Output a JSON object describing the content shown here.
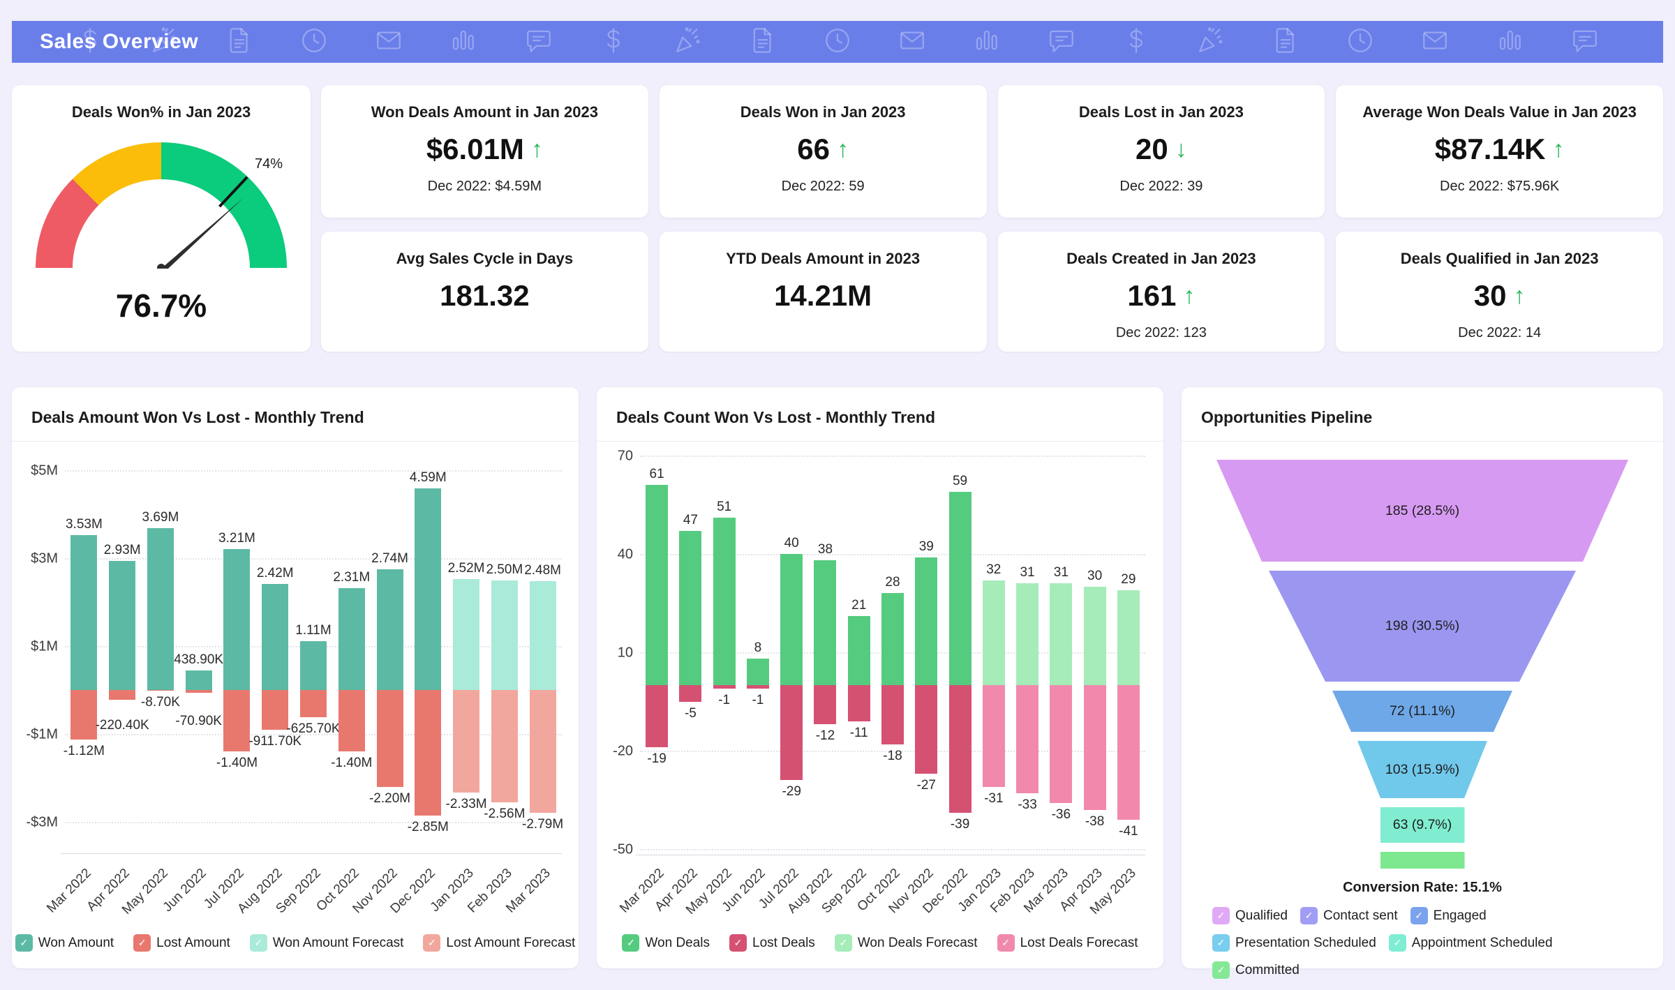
{
  "header": {
    "title": "Sales Overview",
    "bg_color": "#6a7eea",
    "icon_names": [
      "dollar-icon",
      "party-popper-icon",
      "document-icon",
      "clock-icon",
      "envelope-icon",
      "bar-chart-icon",
      "speech-bubble-icon"
    ]
  },
  "arrow_color": "#2db75c",
  "kpi_cards": [
    {
      "title": "Won Deals Amount in Jan 2023",
      "value": "$6.01M",
      "arrow": "up",
      "compare": "Dec 2022: $4.59M"
    },
    {
      "title": "Deals Won in Jan 2023",
      "value": "66",
      "arrow": "up",
      "compare": "Dec 2022: 59"
    },
    {
      "title": "Deals Lost in Jan 2023",
      "value": "20",
      "arrow": "down",
      "compare": "Dec 2022: 39"
    },
    {
      "title": "Average Won Deals Value in Jan 2023",
      "value": "$87.14K",
      "arrow": "up",
      "compare": "Dec 2022: $75.96K"
    },
    {
      "title": "Avg Sales Cycle in Days",
      "value": "181.32",
      "arrow": null,
      "compare": null
    },
    {
      "title": "YTD Deals Amount in 2023",
      "value": "14.21M",
      "arrow": null,
      "compare": null
    },
    {
      "title": "Deals Created in Jan 2023",
      "value": "161",
      "arrow": "up",
      "compare": "Dec 2022: 123"
    },
    {
      "title": "Deals Qualified in Jan 2023",
      "value": "30",
      "arrow": "up",
      "compare": "Dec 2022: 14"
    }
  ],
  "chart_data": [
    {
      "type": "gauge",
      "title": "Deals Won% in Jan 2023",
      "value": 76.7,
      "value_label": "76.7%",
      "target": 74,
      "target_label": "74%",
      "range": [
        0,
        100
      ],
      "zones": [
        {
          "upto": 25,
          "color": "#ef5b64"
        },
        {
          "upto": 50,
          "color": "#fbbd09"
        },
        {
          "upto": 100,
          "color": "#0bcb7c"
        }
      ]
    },
    {
      "type": "bar",
      "title": "Deals Amount Won Vs Lost - Monthly Trend",
      "unit": "USD (millions)",
      "categories": [
        "Mar 2022",
        "Apr 2022",
        "May 2022",
        "Jun 2022",
        "Jul 2022",
        "Aug 2022",
        "Sep 2022",
        "Oct 2022",
        "Nov 2022",
        "Dec 2022",
        "Jan 2023",
        "Feb 2023",
        "Mar 2023"
      ],
      "forecast_start_index": 10,
      "series": [
        {
          "name": "Won Amount",
          "color": "#5cbaa4",
          "forecast_color": "#a9ead9",
          "values": [
            3.53,
            2.93,
            3.69,
            0.4389,
            3.21,
            2.42,
            1.11,
            2.31,
            2.74,
            4.59,
            2.52,
            2.5,
            2.48
          ],
          "labels": [
            "3.53M",
            "2.93M",
            "3.69M",
            "438.90K",
            "3.21M",
            "2.42M",
            "1.11M",
            "2.31M",
            "2.74M",
            "4.59M",
            "2.52M",
            "2.50M",
            "2.48M"
          ]
        },
        {
          "name": "Lost Amount",
          "color": "#e8786e",
          "forecast_color": "#f2a79e",
          "values": [
            -1.12,
            -0.2204,
            -0.0087,
            -0.0709,
            -1.4,
            -0.9117,
            -0.6257,
            -1.4,
            -2.2,
            -2.85,
            -2.33,
            -2.56,
            -2.79
          ],
          "labels": [
            "-1.12M",
            "-220.40K",
            "-8.70K",
            "-70.90K",
            "-1.40M",
            "-911.70K",
            "-625.70K",
            "-1.40M",
            "-2.20M",
            "-2.85M",
            "-2.33M",
            "-2.56M",
            "-2.79M"
          ]
        }
      ],
      "y_ticks": [
        {
          "label": "$5M",
          "value": 5
        },
        {
          "label": "$3M",
          "value": 3
        },
        {
          "label": "$1M",
          "value": 1
        },
        {
          "label": "-$1M",
          "value": -1
        },
        {
          "label": "-$3M",
          "value": -3
        }
      ],
      "ylim": [
        -3.6,
        5.4
      ],
      "legend_position": "bottom",
      "legend": [
        {
          "label": "Won Amount",
          "color": "#5cbaa4"
        },
        {
          "label": "Lost Amount",
          "color": "#e8786e"
        },
        {
          "label": "Won Amount Forecast",
          "color": "#a9ead9"
        },
        {
          "label": "Lost Amount Forecast",
          "color": "#f2a79e"
        }
      ]
    },
    {
      "type": "bar",
      "title": "Deals Count Won Vs Lost - Monthly Trend",
      "unit": "deals",
      "categories": [
        "Mar 2022",
        "Apr 2022",
        "May 2022",
        "Jun 2022",
        "Jul 2022",
        "Aug 2022",
        "Sep 2022",
        "Oct 2022",
        "Nov 2022",
        "Dec 2022",
        "Jan 2023",
        "Feb 2023",
        "Mar 2023",
        "Apr 2023",
        "May 2023"
      ],
      "forecast_start_index": 10,
      "series": [
        {
          "name": "Won Deals",
          "color": "#55cb80",
          "forecast_color": "#a5ecb9",
          "values": [
            61,
            47,
            51,
            8,
            40,
            38,
            21,
            28,
            39,
            59,
            32,
            31,
            31,
            30,
            29
          ],
          "labels": [
            "61",
            "47",
            "51",
            "8",
            "40",
            "38",
            "21",
            "28",
            "39",
            "59",
            "32",
            "31",
            "31",
            "30",
            "29"
          ]
        },
        {
          "name": "Lost Deals",
          "color": "#d55172",
          "forecast_color": "#f189ad",
          "values": [
            -19,
            -5,
            -1,
            -1,
            -29,
            -12,
            -11,
            -18,
            -27,
            -39,
            -31,
            -33,
            -36,
            -38,
            -41
          ],
          "labels": [
            "-19",
            "-5",
            "-1",
            "-1",
            "-29",
            "-12",
            "-11",
            "-18",
            "-27",
            "-39",
            "-31",
            "-33",
            "-36",
            "-38",
            "-41"
          ]
        }
      ],
      "y_ticks": [
        {
          "label": "70",
          "value": 70
        },
        {
          "label": "40",
          "value": 40
        },
        {
          "label": "10",
          "value": 10
        },
        {
          "label": "-20",
          "value": -20
        },
        {
          "label": "-50",
          "value": -50
        }
      ],
      "ylim": [
        -52,
        72
      ],
      "legend_position": "bottom",
      "legend": [
        {
          "label": "Won Deals",
          "color": "#55cb80"
        },
        {
          "label": "Lost Deals",
          "color": "#d55172"
        },
        {
          "label": "Won Deals Forecast",
          "color": "#a5ecb9"
        },
        {
          "label": "Lost Deals Forecast",
          "color": "#f189ad"
        }
      ]
    },
    {
      "type": "funnel",
      "title": "Opportunities Pipeline",
      "conversion_rate_label": "Conversion Rate: 15.1%",
      "stages": [
        {
          "label": "Qualified",
          "value": 185,
          "pct": "28.5%",
          "display": "185 (28.5%)",
          "color": "#d79af2"
        },
        {
          "label": "Contact sent",
          "value": 198,
          "pct": "30.5%",
          "display": "198 (30.5%)",
          "color": "#9b97f0"
        },
        {
          "label": "Engaged",
          "value": 72,
          "pct": "11.1%",
          "display": "72 (11.1%)",
          "color": "#6ea8e8"
        },
        {
          "label": "Presentation Scheduled",
          "value": 103,
          "pct": "15.9%",
          "display": "103 (15.9%)",
          "color": "#70c8ea"
        },
        {
          "label": "Appointment Scheduled",
          "value": 63,
          "pct": "9.7%",
          "display": "63 (9.7%)",
          "color": "#80edd0"
        },
        {
          "label": "Committed",
          "value": null,
          "pct": "",
          "display": "",
          "color": "#7de88f"
        }
      ],
      "legend": [
        {
          "label": "Qualified",
          "color": "#e0a9f6"
        },
        {
          "label": "Contact sent",
          "color": "#a19df4"
        },
        {
          "label": "Engaged",
          "color": "#7ba2ec"
        },
        {
          "label": "Presentation Scheduled",
          "color": "#79cdee"
        },
        {
          "label": "Appointment Scheduled",
          "color": "#7fedd2"
        },
        {
          "label": "Committed",
          "color": "#84e896"
        }
      ]
    }
  ]
}
